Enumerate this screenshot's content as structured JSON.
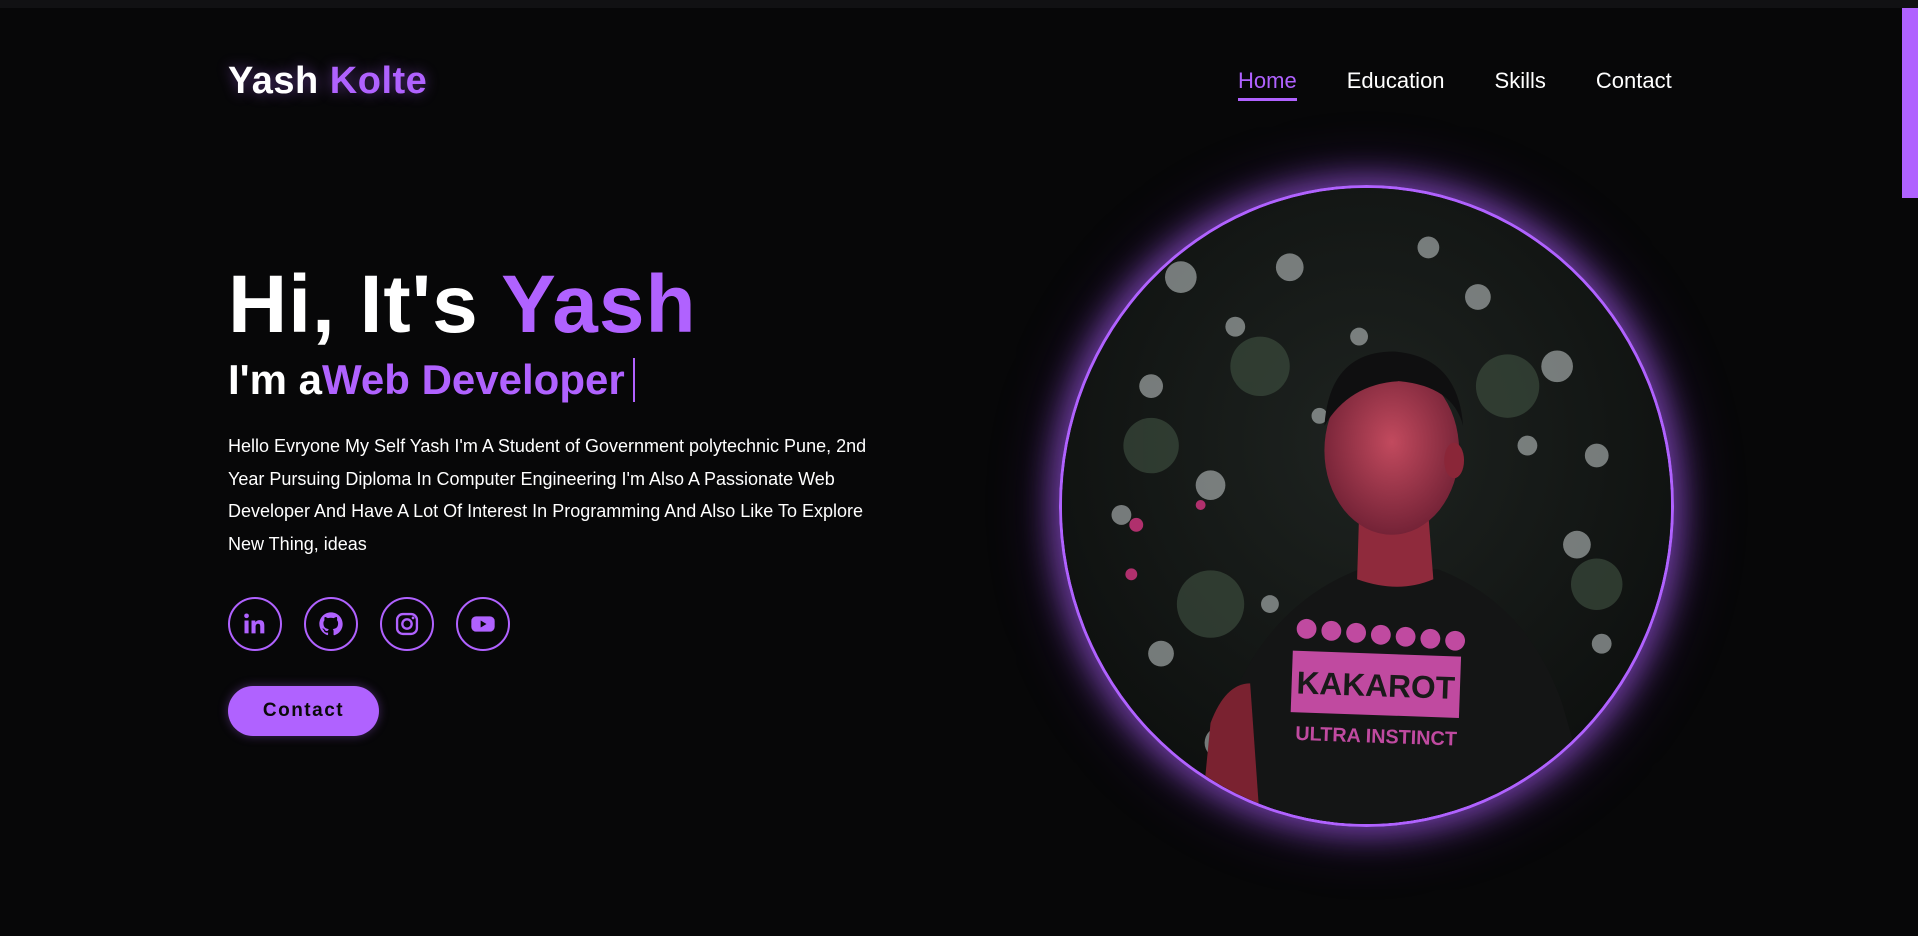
{
  "header": {
    "logo_first": "Yash",
    "logo_second": "Kolte",
    "nav": [
      {
        "label": "Home",
        "active": true
      },
      {
        "label": "Education",
        "active": false
      },
      {
        "label": "Skills",
        "active": false
      },
      {
        "label": "Contact",
        "active": false
      }
    ]
  },
  "hero": {
    "title_prefix": "Hi, It's",
    "title_name": "Yash",
    "sub_prefix": "I'm a",
    "sub_role": "Web Developer",
    "bio": "Hello Evryone My Self Yash I'm A Student of Government polytechnic Pune, 2nd Year Pursuing Diploma In Computer Engineering I'm Also A Passionate Web Developer And Have A Lot Of Interest In Programming And Also Like To Explore New Thing, ideas",
    "contact_button": "Contact"
  },
  "socials": [
    {
      "icon": "linkedin-icon"
    },
    {
      "icon": "github-icon"
    },
    {
      "icon": "instagram-icon"
    },
    {
      "icon": "youtube-icon"
    }
  ],
  "portrait": {
    "shirt_text_top": "KAKAROT",
    "shirt_text_bottom": "ULTRA INSTINCT"
  },
  "colors": {
    "background": "#070708",
    "accent": "#b062ff",
    "text": "#ffffff"
  }
}
